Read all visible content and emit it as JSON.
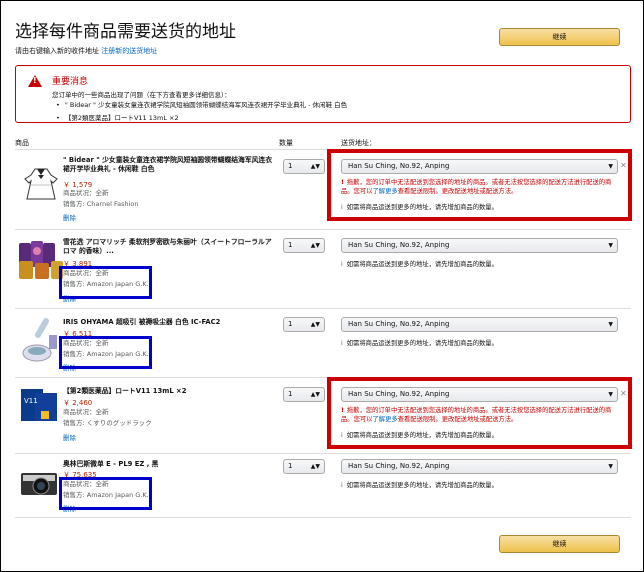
{
  "header": {
    "title": "选择每件商品需要送货的地址",
    "subtitle": "请由右键输入新的收件地址",
    "subtitle_link": "注册新的送货地址",
    "continue_label": "继续"
  },
  "alert": {
    "title": "重要消息",
    "description": "您订单中的一些商品出现了问题（在下方查看更多详细信息）：",
    "items": [
      "\" Bidear \" 少女童装女童连衣裙学院风短袖圆领带蝴蝶结海军风连衣裙开学毕业典礼 - 休闲鞋 白色",
      "【第2類医薬品】ロートV11 13mL ×2"
    ]
  },
  "columns": {
    "product": "商品",
    "quantity": "数量",
    "address": "送货地址："
  },
  "warning_text_a": "拖歉，您的订单中无法配送到您选择的地址的商品。或者无法按您选择的配送方法进行配送的商品。您可以",
  "warning_link": "了解更多",
  "warning_text_b": "查看配送限制。更改配送地址或配送方法。",
  "info_text": "如需将商品运送到更多的地址，请先增加商品的数量。",
  "products": [
    {
      "title": "\" Bidear \" 少女童装女童连衣裙学院风短袖圆领带蝴蝶结海军风连衣裙开学毕业典礼 - 休闲鞋 白色",
      "price": "￥ 1,579",
      "condition": "商品状况：全新",
      "seller": "销售方: Charnel Fashion",
      "delete": "删除",
      "qty": "1",
      "address": "Han Su Ching, No.92, Anping"
    },
    {
      "title": "雪花选 アロマリッチ 柔软剂罗密欧与朱丽叶（スイートフローラルアロマ 的香味）...",
      "price": "￥ 3,891",
      "condition": "商品状况：全新",
      "seller": "销售方: Amazon Japan G.K.",
      "delete": "删除",
      "qty": "1",
      "address": "Han Su Ching, No.92, Anping"
    },
    {
      "title": "IRIS OHYAMA 超吸引 被褥吸尘器 白色 IC-FAC2",
      "price": "￥ 6,511",
      "condition": "商品状况：全新",
      "seller": "销售方: Amazon Japan G.K.",
      "delete": "删除",
      "qty": "1",
      "address": "Han Su Ching, No.92, Anping"
    },
    {
      "title": "【第2類医薬品】ロートV11 13mL ×2",
      "price": "￥ 2,460",
      "condition": "商品状况：全新",
      "seller": "销售方: くすりのグッドラック",
      "delete": "删除",
      "qty": "1",
      "address": "Han Su Ching, No.92, Anping"
    },
    {
      "title": "奥林巴斯微单 E - PL9 EZ , 黑",
      "price": "￥ 75,635",
      "condition": "商品状况：全新",
      "seller": "销售方: Amazon Japan G.K.",
      "delete": "删除",
      "qty": "1",
      "address": "Han Su Ching, No.92, Anping"
    }
  ],
  "icons": {
    "alert": "warning-triangle-icon",
    "info": "info-icon",
    "close": "close-icon",
    "caret": "caret-down-icon"
  },
  "colors": {
    "alert_red": "#c40000",
    "link": "#0066c0",
    "price": "#b12704",
    "button": "#f0c14b",
    "highlight_red": "#cc0000",
    "highlight_blue": "#0000cc"
  }
}
